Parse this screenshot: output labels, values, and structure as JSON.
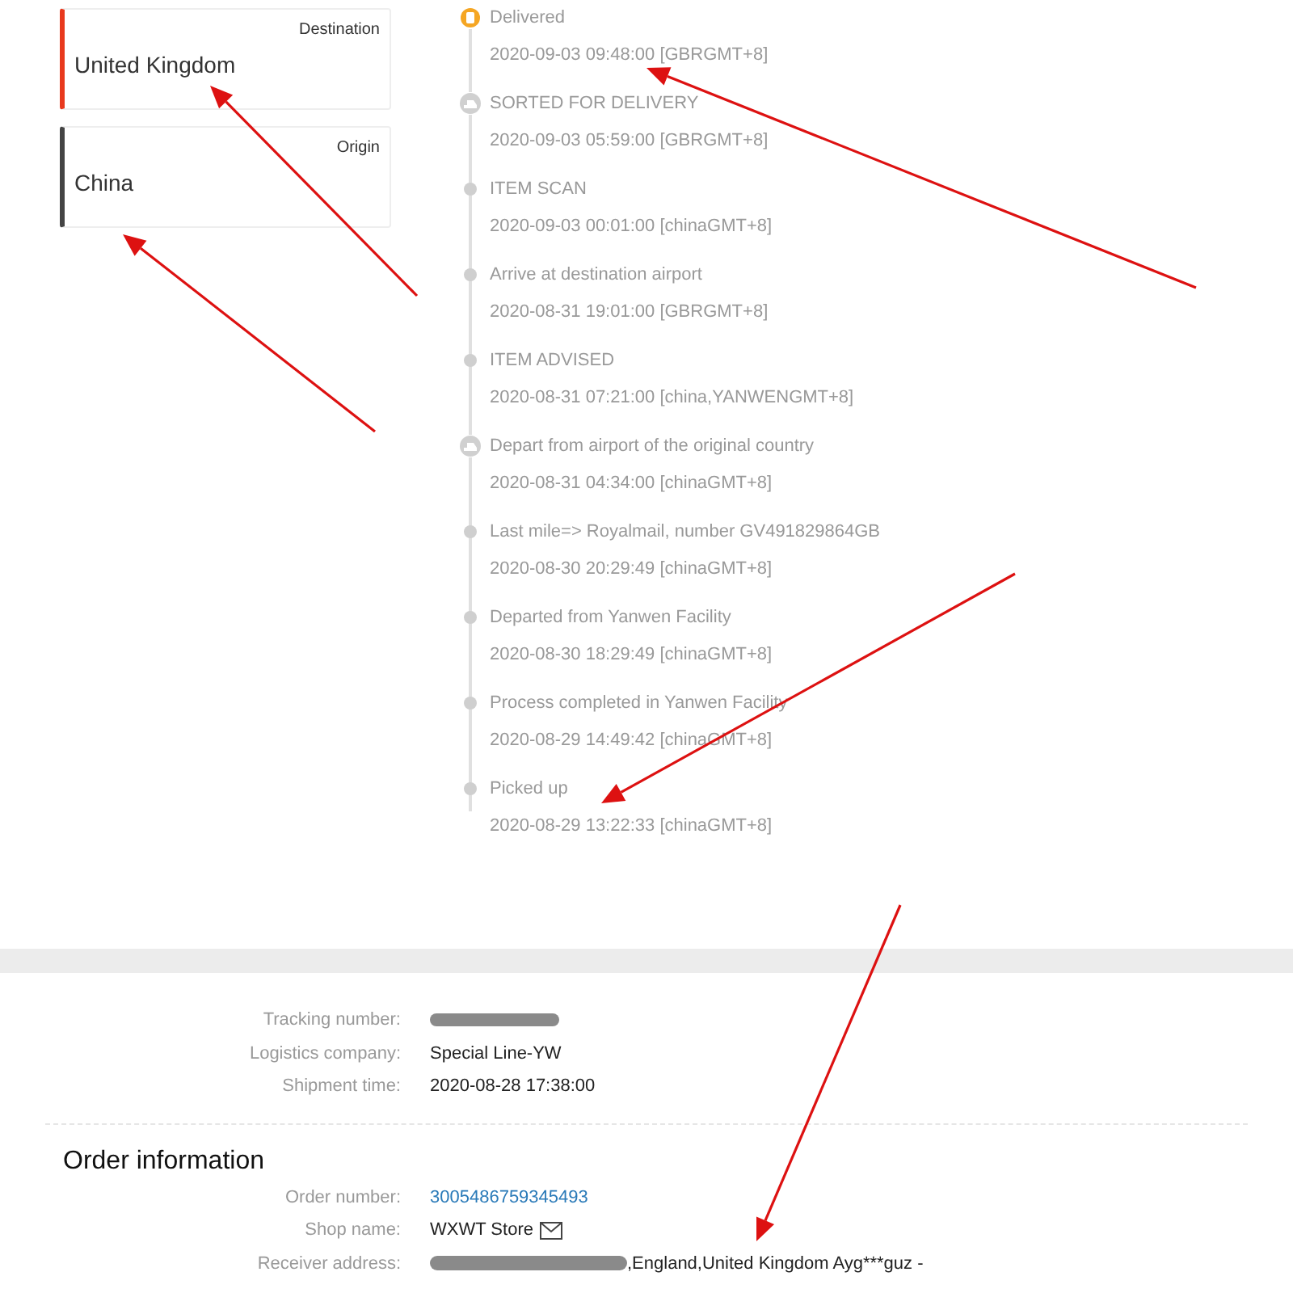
{
  "route": [
    {
      "caption": "Destination",
      "country": "United Kingdom",
      "kind": "destination"
    },
    {
      "caption": "Origin",
      "country": "China",
      "kind": "origin"
    }
  ],
  "events": [
    {
      "kind": "current",
      "status": "Delivered",
      "time": "2020-09-03 09:48:00 [GBRGMT+8]"
    },
    {
      "kind": "milestone",
      "status": "SORTED FOR DELIVERY",
      "time": "2020-09-03 05:59:00 [GBRGMT+8]"
    },
    {
      "kind": "step",
      "status": "ITEM SCAN",
      "time": "2020-09-03 00:01:00 [chinaGMT+8]"
    },
    {
      "kind": "step",
      "status": "Arrive at destination airport",
      "time": "2020-08-31 19:01:00 [GBRGMT+8]"
    },
    {
      "kind": "step",
      "status": "ITEM ADVISED",
      "time": "2020-08-31 07:21:00 [china,YANWENGMT+8]"
    },
    {
      "kind": "milestone",
      "status": "Depart from airport of the original country",
      "time": "2020-08-31 04:34:00 [chinaGMT+8]"
    },
    {
      "kind": "step",
      "status": "Last mile=> Royalmail, number GV491829864GB",
      "time": "2020-08-30 20:29:49 [chinaGMT+8]"
    },
    {
      "kind": "step",
      "status": "Departed from Yanwen Facility",
      "time": "2020-08-30 18:29:49 [chinaGMT+8]"
    },
    {
      "kind": "step",
      "status": "Process completed in Yanwen Facility",
      "time": "2020-08-29 14:49:42 [chinaGMT+8]"
    },
    {
      "kind": "step",
      "status": "Picked up",
      "time": "2020-08-29 13:22:33 [chinaGMT+8]"
    }
  ],
  "shipment": [
    {
      "label": "Tracking number:",
      "kind": "redacted"
    },
    {
      "label": "Logistics company:",
      "kind": "text",
      "value": "Special Line-YW"
    },
    {
      "label": "Shipment time:",
      "kind": "text",
      "value": "2020-08-28 17:38:00"
    }
  ],
  "order": {
    "title": "Order information",
    "rows": [
      {
        "label": "Order number:",
        "kind": "link",
        "value": "3005486759345493"
      },
      {
        "label": "Shop name:",
        "kind": "mail",
        "value": "WXWT Store"
      },
      {
        "label": "Receiver address:",
        "kind": "partly_redacted",
        "value": ",England,United Kingdom Ayg***guz -"
      }
    ]
  }
}
